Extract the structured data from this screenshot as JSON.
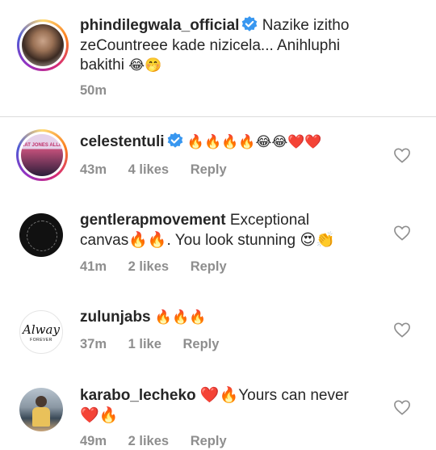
{
  "caption": {
    "username": "phindilegwala_official",
    "text_line1": "Nazike izitho",
    "text_line2": "zeCountreee kade nizicela... Anihluphi",
    "text_line3": "bakithi",
    "emojis": "😂🤭",
    "time": "50m"
  },
  "comments": [
    {
      "username": "celestentuli",
      "text": "🔥🔥🔥🔥😂😂❤️❤️",
      "time": "43m",
      "likes": "4 likes",
      "reply": "Reply",
      "avatar_text": "KAT JONES ALLIAN"
    },
    {
      "username": "gentlerapmovement",
      "text_line1": "Exceptional",
      "text_line2": "canvas🔥🔥. You look stunning 😍👏",
      "time": "41m",
      "likes": "2 likes",
      "reply": "Reply"
    },
    {
      "username": "zulunjabs",
      "text": "🔥🔥🔥",
      "time": "37m",
      "likes": "1 like",
      "reply": "Reply",
      "avatar_text": "Alway",
      "avatar_subtext": "FOREVER"
    },
    {
      "username": "karabo_lecheko",
      "text_line1": "❤️🔥Yours can never",
      "text_line2": "❤️🔥",
      "time": "49m",
      "likes": "2 likes",
      "reply": "Reply"
    }
  ],
  "colors": {
    "verified": "#3897f0",
    "meta": "#8e8e8e",
    "text": "#262626"
  }
}
